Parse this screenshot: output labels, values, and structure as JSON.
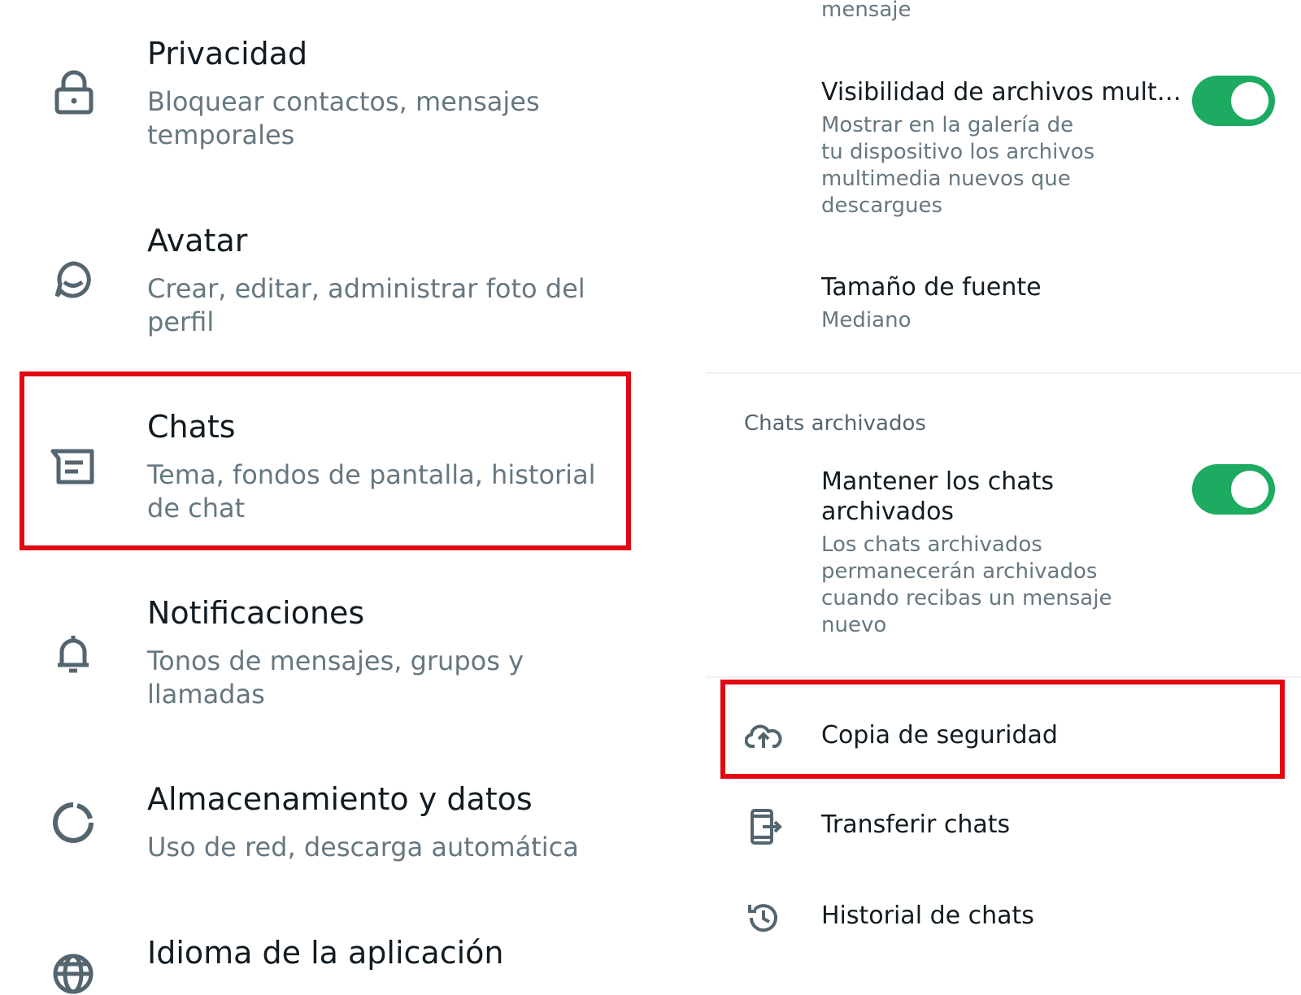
{
  "left_panel": {
    "items": [
      {
        "title": "Privacidad",
        "subtitle": "Bloquear contactos, mensajes temporales",
        "icon": "lock-icon"
      },
      {
        "title": "Avatar",
        "subtitle": "Crear, editar, administrar foto del perfil",
        "icon": "avatar-face-icon"
      },
      {
        "title": "Chats",
        "subtitle": "Tema, fondos de pantalla, historial de chat",
        "icon": "chat-icon"
      },
      {
        "title": "Notificaciones",
        "subtitle": "Tonos de mensajes, grupos y llamadas",
        "icon": "bell-icon"
      },
      {
        "title": "Almacenamiento y datos",
        "subtitle": "Uso de red, descarga automática",
        "icon": "storage-circle-icon"
      },
      {
        "title": "Idioma de la aplicación",
        "icon": "globe-icon"
      }
    ]
  },
  "right_panel": {
    "top_cut_text": "mensaje",
    "media_visibility": {
      "title": "Visibilidad de archivos mult…",
      "subtitle_lines": [
        "Mostrar en la galería de",
        "tu dispositivo los archivos",
        "multimedia nuevos que",
        "descargues"
      ],
      "toggle_on": true
    },
    "font_size": {
      "title": "Tamaño de fuente",
      "value": "Mediano"
    },
    "archived_section": {
      "header": "Chats archivados",
      "keep_archived": {
        "title_lines": [
          "Mantener los chats",
          "archivados"
        ],
        "subtitle_lines": [
          "Los chats archivados",
          "permanecerán archivados",
          "cuando recibas un mensaje",
          "nuevo"
        ],
        "toggle_on": true
      }
    },
    "actions": [
      {
        "label": "Copia de seguridad",
        "icon": "cloud-upload-icon"
      },
      {
        "label": "Transferir chats",
        "icon": "phone-transfer-icon"
      },
      {
        "label": "Historial de chats",
        "icon": "history-icon"
      }
    ]
  },
  "colors": {
    "primary_text": "#111b21",
    "secondary_text": "#667781",
    "icon": "#54656f",
    "toggle_on": "#1daa61",
    "highlight_box": "#e30613"
  }
}
